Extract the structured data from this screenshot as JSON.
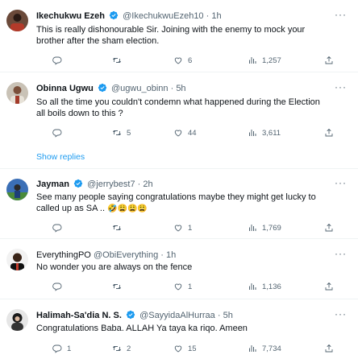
{
  "tweets": [
    {
      "name": "Ikechukwu Ezeh",
      "handle": "@IkechukwuEzeh10",
      "time": "1h",
      "text_line1": "This is really dishonourable Sir. Joining with the enemy to mock your",
      "text_line2": "brother after the sham election.",
      "replies": "",
      "retweets": "",
      "likes": "6",
      "views": "1,257"
    },
    {
      "name": "Obinna Ugwu",
      "handle": "@ugwu_obinn",
      "time": "5h",
      "text_line1": "So all the time you couldn't condemn what happened during the Election",
      "text_line2": "all boils down to this ?",
      "replies": "",
      "retweets": "5",
      "likes": "44",
      "views": "3,611"
    },
    {
      "name": "Jayman",
      "handle": "@jerrybest7",
      "time": "2h",
      "text_line1": "See many people saying congratulations maybe they might get lucky to",
      "text_line2": "called up as SA ..",
      "text_emoji": "🤣😩😩😩",
      "replies": "",
      "retweets": "",
      "likes": "1",
      "views": "1,769"
    },
    {
      "name": "EverythingPO",
      "handle": "@ObiEverything",
      "time": "1h",
      "text_line1": "No wonder you are always on the fence",
      "replies": "",
      "retweets": "",
      "likes": "1",
      "views": "1,136"
    },
    {
      "name": "Halimah-Sa'dia N. S.",
      "handle": "@SayyidaAlHurraa",
      "time": "5h",
      "text_line1": "Congratulations Baba. ALLAH Ya taya ka riqo. Ameen",
      "replies": "1",
      "retweets": "2",
      "likes": "15",
      "views": "7,734"
    }
  ],
  "show_replies": "Show replies",
  "dot": "·",
  "more": "···",
  "colors": {
    "verified": "#1d9bf0",
    "muted": "#536471",
    "link": "#1d9bf0",
    "divider": "#eff3f4"
  },
  "icons": [
    "more-icon",
    "verified-badge-icon",
    "reply-icon",
    "retweet-icon",
    "like-icon",
    "views-icon",
    "share-icon"
  ]
}
